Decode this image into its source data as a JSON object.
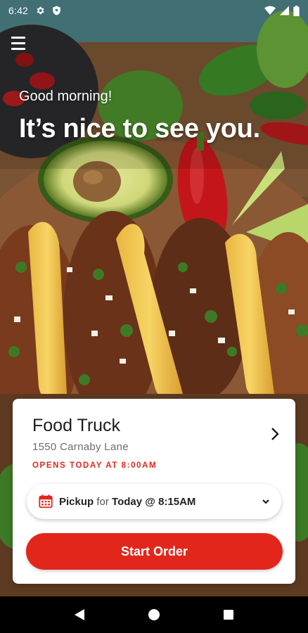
{
  "status_bar": {
    "time": "6:42"
  },
  "hero": {
    "greeting": "Good morning!",
    "headline": "It’s nice to see you."
  },
  "location": {
    "name": "Food Truck",
    "address": "1550 Carnaby Lane",
    "hours": "OPENS TODAY AT 8:00AM"
  },
  "pickup": {
    "mode": "Pickup",
    "connector": "for",
    "time": "Today @ 8:15AM"
  },
  "start_order": {
    "label": "Start Order"
  },
  "colors": {
    "accent": "#e3261b",
    "card": "#ffffff"
  }
}
